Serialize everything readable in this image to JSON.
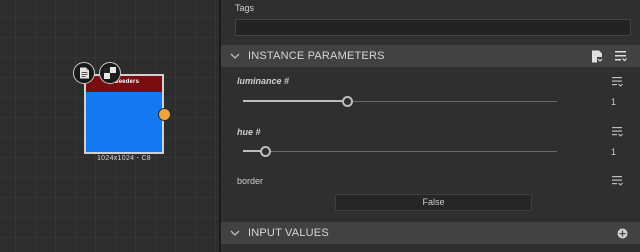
{
  "graph": {
    "node": {
      "title": "mSeeders",
      "caption": "1024x1024 - C8",
      "header_color": "#7a0d10",
      "body_color": "#1478f2",
      "port_color": "#f0a33c",
      "icons": [
        "document-icon",
        "checker-icon"
      ]
    }
  },
  "panel": {
    "tags": {
      "label": "Tags",
      "value": ""
    },
    "instance_parameters": {
      "title": "INSTANCE PARAMETERS",
      "params": [
        {
          "label": "luminance #",
          "value": "1",
          "fraction": 0.33
        },
        {
          "label": "hue #",
          "value": "1",
          "fraction": 0.07
        }
      ],
      "border": {
        "label": "border",
        "value": "False"
      }
    },
    "input_values": {
      "title": "INPUT VALUES"
    }
  }
}
